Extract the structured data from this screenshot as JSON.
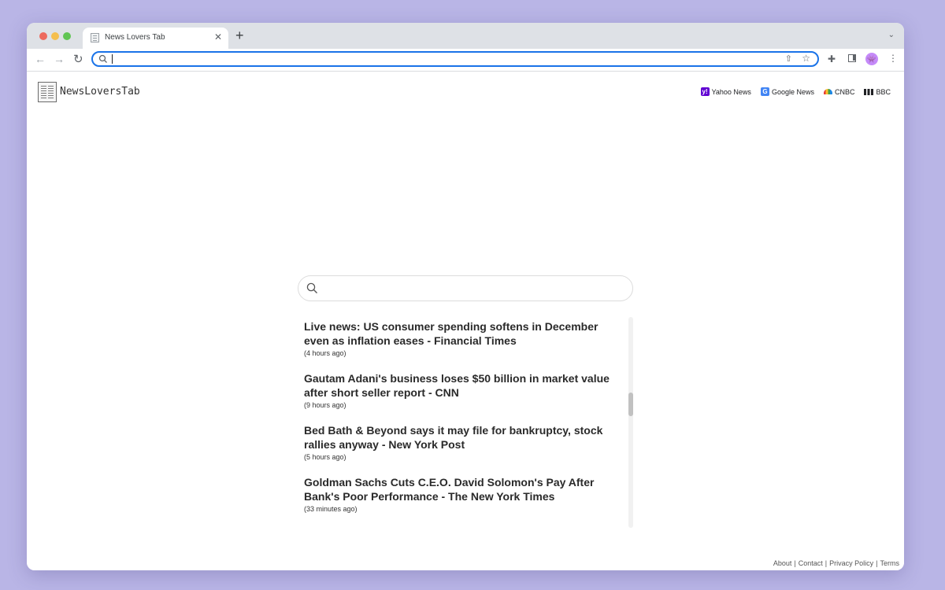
{
  "browser": {
    "tab_title": "News Lovers Tab",
    "tab_close": "✕",
    "new_tab": "+",
    "tab_menu": "⌄",
    "back": "←",
    "forward": "→",
    "reload": "↻",
    "address_value": "",
    "share": "⇧",
    "bookmark": "☆",
    "extensions": "✚",
    "menu": "⋮",
    "avatar": "👾"
  },
  "site": {
    "logo_text": "NewsLoversTab",
    "shortcuts": [
      {
        "label": "Yahoo News",
        "icon": "yahoo-icon",
        "glyph": "y!"
      },
      {
        "label": "Google News",
        "icon": "google-news-icon",
        "glyph": "G"
      },
      {
        "label": "CNBC",
        "icon": "cnbc-icon",
        "glyph": ""
      },
      {
        "label": "BBC",
        "icon": "bbc-icon",
        "glyph": ""
      }
    ],
    "search_placeholder": ""
  },
  "news": [
    {
      "title": "Live news: US consumer spending softens in December even as inflation eases - Financial Times",
      "time": "(4 hours ago)"
    },
    {
      "title": "Gautam Adani's business loses $50 billion in market value after short seller report - CNN",
      "time": "(9 hours ago)"
    },
    {
      "title": "Bed Bath & Beyond says it may file for bankruptcy, stock rallies anyway - New York Post",
      "time": "(5 hours ago)"
    },
    {
      "title": "Goldman Sachs Cuts C.E.O. David Solomon's Pay After Bank's Poor Performance - The New York Times",
      "time": "(33 minutes ago)"
    }
  ],
  "footer": {
    "links": [
      "About",
      "Contact",
      "Privacy Policy",
      "Terms"
    ],
    "separator": "|"
  },
  "colors": {
    "background": "#b9b5e6",
    "omnibox_focus": "#1a73e8",
    "yahoo": "#6001d2"
  }
}
